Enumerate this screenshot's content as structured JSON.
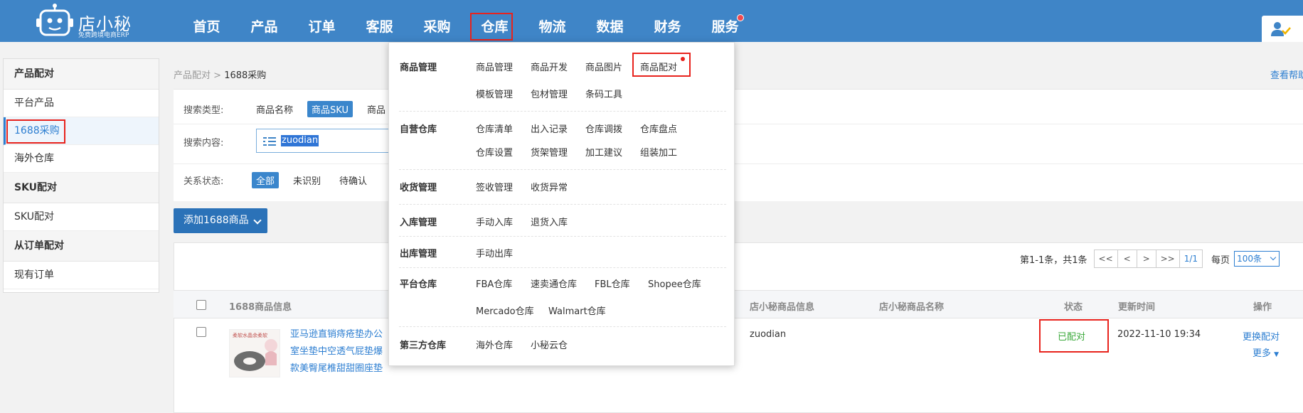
{
  "brand": {
    "name": "店小秘",
    "subtitle": "免费跨境电商ERP"
  },
  "nav": {
    "items": [
      "首页",
      "产品",
      "订单",
      "客服",
      "采购",
      "仓库",
      "物流",
      "数据",
      "财务",
      "服务"
    ],
    "active": "仓库",
    "badge_on": "服务"
  },
  "sidebar": {
    "groups": [
      {
        "title": "产品配对",
        "items": [
          "平台产品",
          "1688采购",
          "海外仓库"
        ]
      },
      {
        "title": "SKU配对",
        "items": [
          "SKU配对"
        ]
      },
      {
        "title": "从订单配对",
        "items": [
          "现有订单"
        ]
      }
    ],
    "active_item": "1688采购"
  },
  "breadcrumb": {
    "parent": "产品配对",
    "separator": ">",
    "current": "1688采购"
  },
  "help_link": "查看帮助",
  "filters": {
    "search_type_label": "搜索类型:",
    "search_type_options": [
      "商品名称",
      "商品SKU",
      "商品"
    ],
    "search_type_selected": "商品SKU",
    "search_content_label": "搜索内容:",
    "search_value": "zuodian",
    "relation_label": "关系状态:",
    "relation_options": [
      "全部",
      "未识别",
      "待确认"
    ],
    "relation_selected": "全部"
  },
  "add_button": "添加1688商品",
  "pagination": {
    "summary": "第1-1条，共1条",
    "first": "<<",
    "prev": "<",
    "next": ">",
    "last": ">>",
    "page": "1/1",
    "per_page_label": "每页",
    "per_page_value": "100条"
  },
  "table": {
    "headers": {
      "info_1688": "1688商品信息",
      "dxm_info": "店小秘商品信息",
      "dxm_name": "店小秘商品名称",
      "status": "状态",
      "updated": "更新时间",
      "actions": "操作"
    },
    "rows": [
      {
        "title": "亚马逊直销痔疮垫办公室坐垫中空透气屁垫爆款美臀尾椎甜甜圈座垫",
        "image_caption": "柔软水晶余柔软",
        "dxm_info": "zuodian",
        "status": "已配对",
        "updated": "2022-11-10 19:34",
        "action_primary": "更换配对",
        "action_more": "更多"
      }
    ]
  },
  "dropdown": {
    "sections": [
      {
        "title": "商品管理",
        "links": [
          "商品管理",
          "商品开发",
          "商品图片",
          "商品配对",
          "模板管理",
          "包材管理",
          "条码工具"
        ],
        "highlight": "商品配对"
      },
      {
        "title": "自营仓库",
        "links": [
          "仓库清单",
          "出入记录",
          "仓库调拨",
          "仓库盘点",
          "仓库设置",
          "货架管理",
          "加工建议",
          "组装加工"
        ]
      },
      {
        "title": "收货管理",
        "links": [
          "签收管理",
          "收货异常"
        ]
      },
      {
        "title": "入库管理",
        "links": [
          "手动入库",
          "退货入库"
        ]
      },
      {
        "title": "出库管理",
        "links": [
          "手动出库"
        ]
      },
      {
        "title": "平台仓库",
        "links": [
          "FBA仓库",
          "速卖通仓库",
          "FBL仓库",
          "Shopee仓库",
          "Mercado仓库",
          "Walmart仓库"
        ]
      },
      {
        "title": "第三方仓库",
        "links": [
          "海外仓库",
          "小秘云仓"
        ]
      }
    ]
  },
  "colors": {
    "header": "#3f85c7",
    "accent": "#2c7ed1",
    "highlight": "#e8231d",
    "success": "#3aa93a"
  }
}
